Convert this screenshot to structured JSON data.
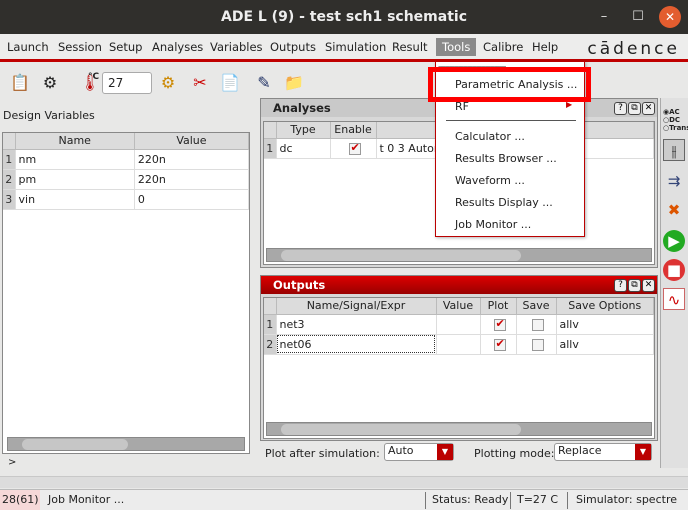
{
  "window": {
    "title": "ADE L (9) - test sch1 schematic",
    "minimize": "–",
    "maximize": "☐",
    "close": "✕"
  },
  "menubar": {
    "items": [
      "Launch",
      "Session",
      "Setup",
      "Analyses",
      "Variables",
      "Outputs",
      "Simulation",
      "Result",
      "Tools",
      "Calibre",
      "Help"
    ],
    "logo": "cādence"
  },
  "toolbar": {
    "temperature_label": "°C",
    "temperature": "27"
  },
  "design_variables": {
    "title": "Design Variables",
    "columns": [
      "Name",
      "Value"
    ],
    "rows": [
      {
        "n": "1",
        "name": "nm",
        "value": "220n"
      },
      {
        "n": "2",
        "name": "pm",
        "value": "220n"
      },
      {
        "n": "3",
        "name": "vin",
        "value": "0"
      }
    ],
    "prompt": ">"
  },
  "analyses": {
    "title": "Analyses",
    "columns": [
      "Type",
      "Enable",
      ""
    ],
    "rows": [
      {
        "n": "1",
        "type": "dc",
        "enabled": true,
        "args": "t 0 3 Autom"
      }
    ]
  },
  "outputs": {
    "title": "Outputs",
    "columns": [
      "Name/Signal/Expr",
      "Value",
      "Plot",
      "Save",
      "Save Options"
    ],
    "rows": [
      {
        "n": "1",
        "name": "net3",
        "value": "",
        "plot": true,
        "save": false,
        "options": "allv"
      },
      {
        "n": "2",
        "name": "net06",
        "value": "",
        "plot": true,
        "save": false,
        "options": "allv"
      }
    ]
  },
  "plot_controls": {
    "plot_after_label": "Plot after simulation:",
    "plot_after_value": "Auto",
    "mode_label": "Plotting mode:",
    "mode_value": "Replace"
  },
  "tools_menu": {
    "tearoff": "------------------------------",
    "items": [
      "Parametric Analysis ...",
      "RF",
      "Calculator ...",
      "Results Browser ...",
      "Waveform ...",
      "Results Display ...",
      "Job Monitor ..."
    ]
  },
  "right_toolbar": {
    "radios": [
      "AC",
      "DC",
      "Trans"
    ],
    "selected": "AC"
  },
  "statusbar": {
    "counter": "28(61)",
    "message": "Job Monitor ...",
    "status": "Status: Ready",
    "temp": "T=27  C",
    "simulator": "Simulator: spectre"
  },
  "colors": {
    "accent": "#c00000",
    "highlight": "#ff0000"
  }
}
